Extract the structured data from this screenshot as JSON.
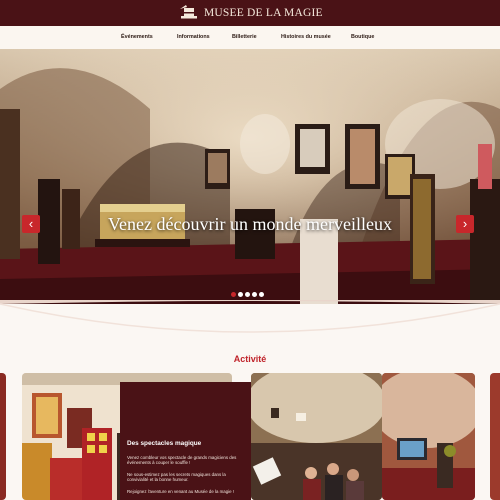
{
  "header": {
    "brand": "MUSEE DE LA MAGIE",
    "logo_icon": "magician-hat-icon",
    "background_color": "#4a1216"
  },
  "nav": {
    "items": [
      {
        "label": "Événements"
      },
      {
        "label": "Informations"
      },
      {
        "label": "Billetterie"
      },
      {
        "label": "Histoires du musée"
      },
      {
        "label": "Boutique"
      }
    ]
  },
  "hero": {
    "title": "Venez découvrir un monde merveilleux",
    "prev_icon": "chevron-left-icon",
    "next_icon": "chevron-right-icon",
    "prev_glyph": "‹",
    "next_glyph": "›",
    "slide_count": 5,
    "active_slide": 1,
    "accent_color": "#c8272b"
  },
  "activity": {
    "title": "Activité",
    "title_color": "#c0242b",
    "card": {
      "title": "Des spectacles magique",
      "paragraph_1": "Venez combleur vos spectacle de grands magiciens des événements à couper le souffle !",
      "paragraph_2": "Ne sous-estimez pas les secrets magiques dans la convivialité et la bonne humeur.",
      "paragraph_3": "Rejoignez l'aventure en venant au Musée de la magie !"
    }
  }
}
